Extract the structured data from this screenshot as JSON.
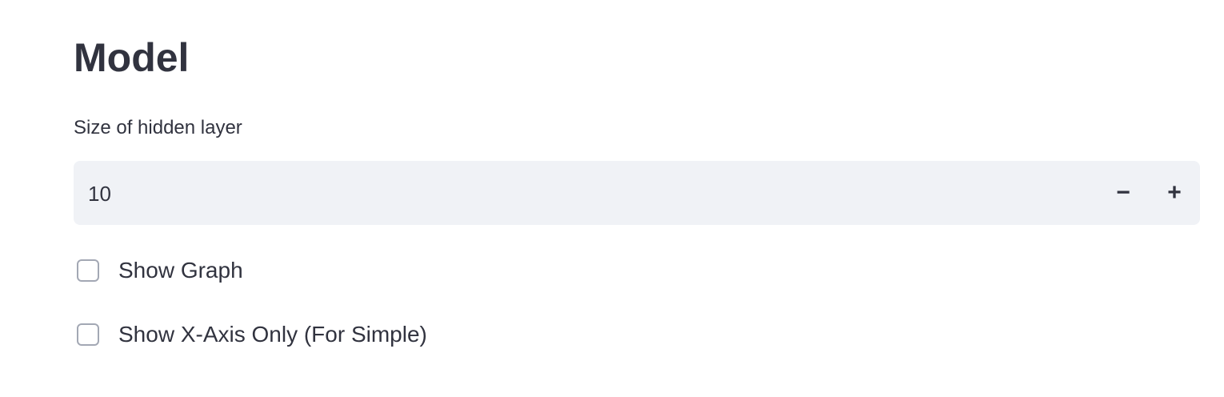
{
  "title": "Model",
  "hidden_layer": {
    "label": "Size of hidden layer",
    "value": "10",
    "minus": "−",
    "plus": "+"
  },
  "checkboxes": [
    {
      "label": "Show Graph",
      "checked": false
    },
    {
      "label": "Show X-Axis Only (For Simple)",
      "checked": false
    }
  ]
}
